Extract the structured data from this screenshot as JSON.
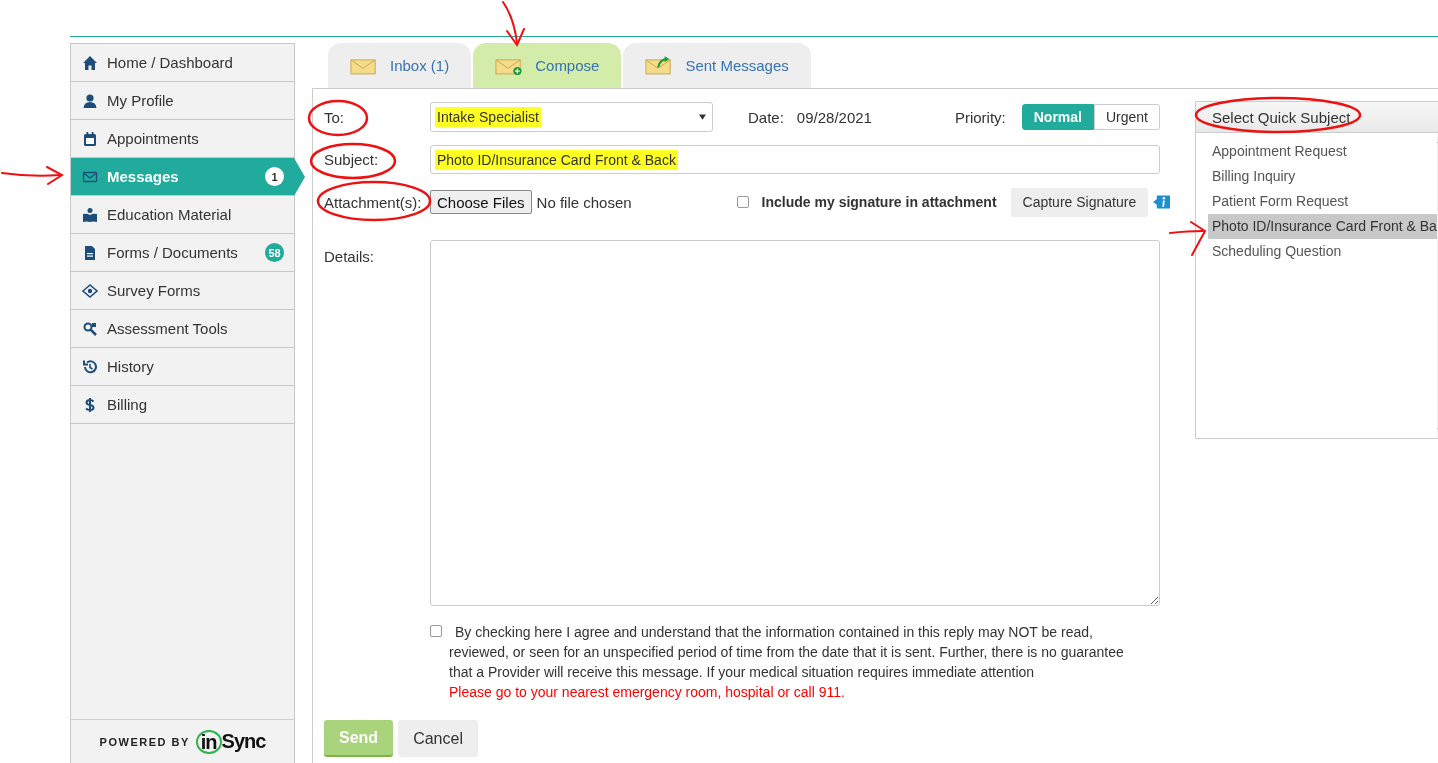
{
  "sidebar": {
    "items": [
      {
        "label": "Home / Dashboard",
        "selected": false
      },
      {
        "label": "My Profile",
        "selected": false
      },
      {
        "label": "Appointments",
        "selected": false
      },
      {
        "label": "Messages",
        "badge": "1",
        "selected": true
      },
      {
        "label": "Education Material",
        "selected": false
      },
      {
        "label": "Forms / Documents",
        "badge": "58",
        "selected": false
      },
      {
        "label": "Survey Forms",
        "selected": false
      },
      {
        "label": "Assessment Tools",
        "selected": false
      },
      {
        "label": "History",
        "selected": false
      },
      {
        "label": "Billing",
        "selected": false
      }
    ],
    "footer": {
      "prefix": "POWERED BY",
      "logo_part_1": "in",
      "logo_part_2": "Sync"
    }
  },
  "tabs": [
    {
      "label": "Inbox (1)",
      "selected": false
    },
    {
      "label": "Compose",
      "selected": true
    },
    {
      "label": "Sent Messages",
      "selected": false
    }
  ],
  "form": {
    "to": {
      "label": "To:",
      "value": "Intake Specialist",
      "highlighted": true
    },
    "date": {
      "label": "Date:",
      "value": "09/28/2021"
    },
    "priority": {
      "label": "Priority:",
      "options": [
        {
          "label": "Normal",
          "selected": true
        },
        {
          "label": "Urgent",
          "selected": false
        }
      ]
    },
    "subject": {
      "label": "Subject:",
      "value": "Photo ID/Insurance Card Front & Back",
      "highlighted": true
    },
    "attachment": {
      "label": "Attachment(s):",
      "button": "Choose Files",
      "status": "No file chosen"
    },
    "signature": {
      "label": "Include my signature in attachment",
      "checked": false
    },
    "capture_button": "Capture Signature",
    "details": {
      "label": "Details:"
    },
    "agreement": {
      "checked": false,
      "text": "By checking here I agree and understand that the information contained in this reply may NOT be read, reviewed, or seen for an unspecified period of time from the date that it is sent. Further, there is no guarantee that a Provider will receive this message. If your medical situation requires immediate attention",
      "warning": "Please go to your nearest emergency room, hospital or call 911."
    },
    "buttons": [
      {
        "label": "Send",
        "disabled": true
      },
      {
        "label": "Cancel",
        "disabled": false
      }
    ]
  },
  "quick_subject": {
    "title": "Select Quick Subject",
    "items": [
      {
        "label": "Appointment Request",
        "selected": false
      },
      {
        "label": "Billing Inquiry",
        "selected": false
      },
      {
        "label": "Patient Form Request",
        "selected": false
      },
      {
        "label": "Photo ID/Insurance Card Front & Ba",
        "selected": true
      },
      {
        "label": "Scheduling Question",
        "selected": false
      }
    ]
  },
  "annotations": [
    {
      "kind": "arrow"
    },
    {
      "kind": "arrow"
    },
    {
      "kind": "arrow"
    },
    {
      "kind": "circle"
    },
    {
      "kind": "circle"
    },
    {
      "kind": "circle"
    },
    {
      "kind": "circle"
    }
  ]
}
